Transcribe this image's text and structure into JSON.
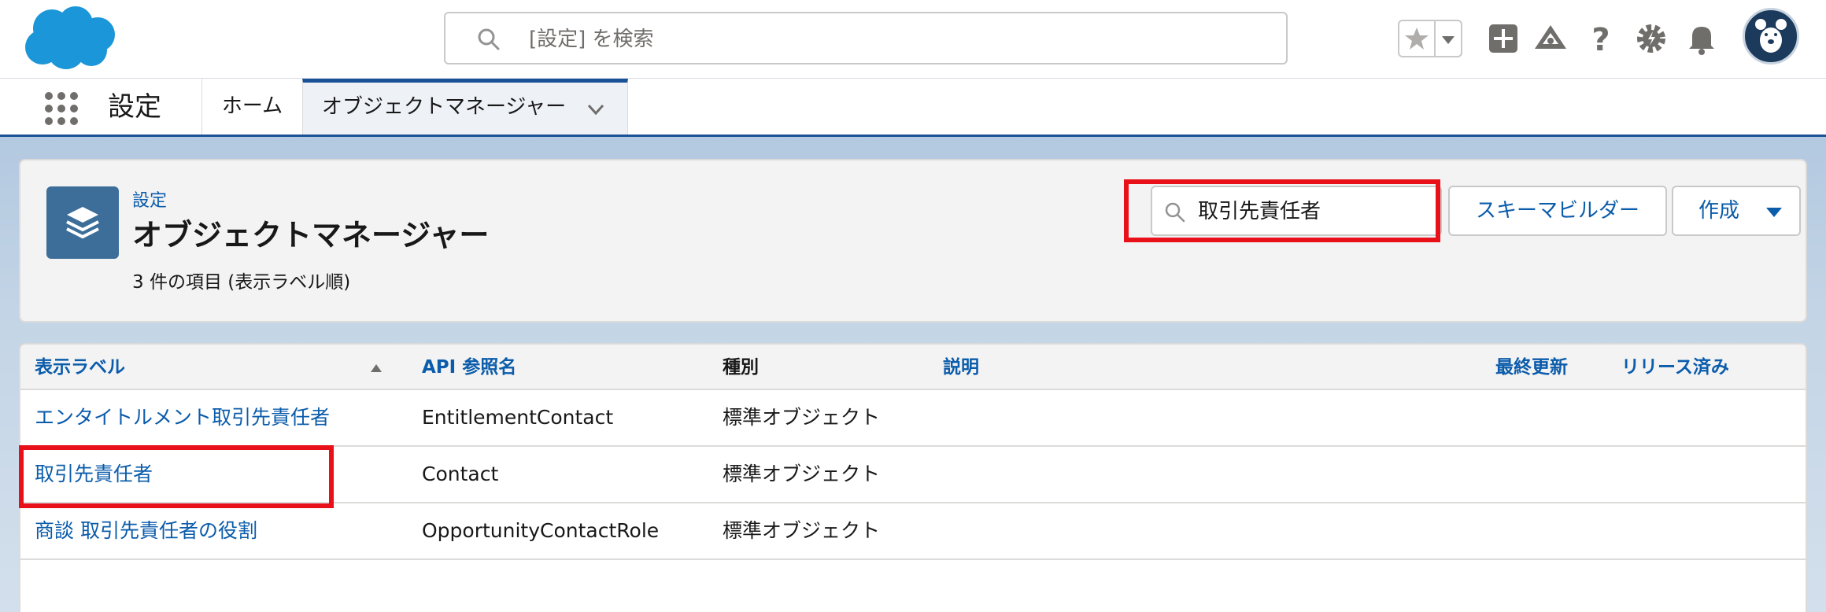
{
  "header": {
    "search_placeholder": "[設定] を検索"
  },
  "nav": {
    "app_name": "設定",
    "tabs": [
      {
        "label": "ホーム"
      },
      {
        "label": "オブジェクトマネージャー"
      }
    ]
  },
  "page": {
    "breadcrumb": "設定",
    "title": "オブジェクトマネージャー",
    "subtitle": "3 件の項目 (表示ラベル順)",
    "quick_find_value": "取引先責任者",
    "schema_button": "スキーマビルダー",
    "create_button": "作成"
  },
  "table": {
    "columns": [
      "表示ラベル",
      "API 参照名",
      "種別",
      "説明",
      "最終更新",
      "リリース済み"
    ],
    "rows": [
      {
        "label": "エンタイトルメント取引先責任者",
        "api": "EntitlementContact",
        "type": "標準オブジェクト"
      },
      {
        "label": "取引先責任者",
        "api": "Contact",
        "type": "標準オブジェクト"
      },
      {
        "label": "商談 取引先責任者の役割",
        "api": "OpportunityContactRole",
        "type": "標準オブジェクト"
      }
    ]
  },
  "colors": {
    "brand_blue": "#0b5cab",
    "highlight_red": "#e8111a",
    "cloud_blue": "#1b96d8"
  },
  "icons": [
    "salesforce-cloud-icon",
    "search-icon",
    "star-icon",
    "add-icon",
    "trailhead-icon",
    "help-icon",
    "setup-gear-icon",
    "bell-icon",
    "app-launcher-icon",
    "chevron-down-icon",
    "layers-icon",
    "sort-up-icon"
  ]
}
